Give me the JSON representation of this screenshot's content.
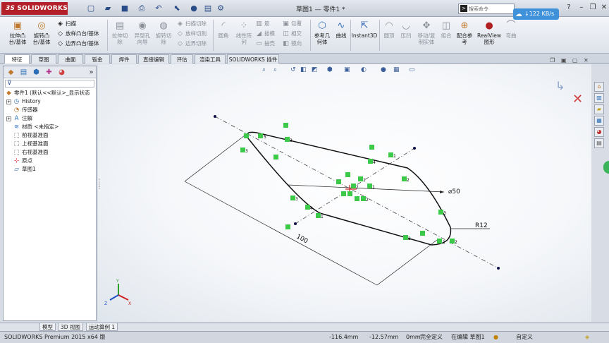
{
  "app": {
    "logo": "SOLIDWORKS",
    "window_title": "草图1 — 零件1 *",
    "search_placeholder": "搜索命令",
    "net_speed": "122 KB/s"
  },
  "ribbon": {
    "big_buttons": [
      {
        "label": "拉伸凸\n台/基体",
        "icon": "extrude-boss-icon"
      },
      {
        "label": "旋转凸\n台/基体",
        "icon": "revolve-boss-icon"
      },
      {
        "label": "拉伸切\n除",
        "icon": "extrude-cut-icon"
      },
      {
        "label": "异型孔\n向导",
        "icon": "hole-wizard-icon"
      },
      {
        "label": "旋转切\n除",
        "icon": "revolve-cut-icon"
      },
      {
        "label": "圆角",
        "icon": "fillet-icon"
      },
      {
        "label": "线性阵\n列",
        "icon": "linear-pattern-icon"
      },
      {
        "label": "参考几\n何体",
        "icon": "ref-geometry-icon"
      },
      {
        "label": "曲线",
        "icon": "curves-icon"
      },
      {
        "label": "Instant3D",
        "icon": "instant3d-icon"
      },
      {
        "label": "圆顶",
        "icon": "dome-icon"
      },
      {
        "label": "压凹",
        "icon": "indent-icon"
      },
      {
        "label": "移动/复\n制实体",
        "icon": "move-copy-icon"
      },
      {
        "label": "组合",
        "icon": "combine-icon"
      },
      {
        "label": "配合参\n考",
        "icon": "mate-ref-icon"
      },
      {
        "label": "RealView\n图形",
        "icon": "realview-icon"
      },
      {
        "label": "弯曲",
        "icon": "flex-icon"
      }
    ],
    "small_buttons": [
      {
        "label": "扫描",
        "icon": "sweep-icon"
      },
      {
        "label": "放样凸台/基体",
        "icon": "loft-icon"
      },
      {
        "label": "边界凸台/基体",
        "icon": "boundary-icon"
      },
      {
        "label": "扫描切除",
        "icon": "swept-cut-icon"
      },
      {
        "label": "放样切割",
        "icon": "lofted-cut-icon"
      },
      {
        "label": "边界切除",
        "icon": "boundary-cut-icon"
      },
      {
        "label": "筋",
        "icon": "rib-icon"
      },
      {
        "label": "拔模",
        "icon": "draft-icon"
      },
      {
        "label": "抽壳",
        "icon": "shell-icon"
      },
      {
        "label": "包覆",
        "icon": "wrap-icon"
      },
      {
        "label": "相交",
        "icon": "intersect-icon"
      },
      {
        "label": "镜向",
        "icon": "mirror-icon"
      }
    ]
  },
  "tabs": [
    "特征",
    "草图",
    "曲面",
    "钣金",
    "焊件",
    "直接编辑",
    "评估",
    "渲染工具",
    "SOLIDWORKS 插件"
  ],
  "tree": {
    "root": "零件1 (默认<<默认>_显示状态",
    "items": [
      {
        "label": "History",
        "icon": "history-icon"
      },
      {
        "label": "传感器",
        "icon": "sensor-icon"
      },
      {
        "label": "注解",
        "icon": "annotation-icon"
      },
      {
        "label": "材质 <未指定>",
        "icon": "material-icon"
      },
      {
        "label": "前视基准面",
        "icon": "plane-icon"
      },
      {
        "label": "上视基准面",
        "icon": "plane-icon"
      },
      {
        "label": "右视基准面",
        "icon": "plane-icon"
      },
      {
        "label": "原点",
        "icon": "origin-icon"
      },
      {
        "label": "草图1",
        "icon": "sketch-icon"
      }
    ]
  },
  "sketch": {
    "dim_diameter": "⌀50",
    "dim_radius": "R12",
    "dim_length": "100",
    "relation_labels": [
      "5",
      "3",
      "3",
      "4",
      "1",
      "2",
      "1",
      "2",
      "1",
      "2",
      "3",
      "4",
      "1",
      "2",
      "3",
      "1",
      "2",
      "1"
    ]
  },
  "triad": {
    "x": "X",
    "y": "Y",
    "z": "Z"
  },
  "model_tabs": [
    "模型",
    "3D 视图",
    "运动算例 1"
  ],
  "status": {
    "product": "SOLIDWORKS Premium 2015 x64 版",
    "x": "-116.4mm",
    "y": "-12.57mm",
    "z": "0mm",
    "defined": "完全定义",
    "editing": "在编辑 草图1",
    "units": "自定义"
  }
}
